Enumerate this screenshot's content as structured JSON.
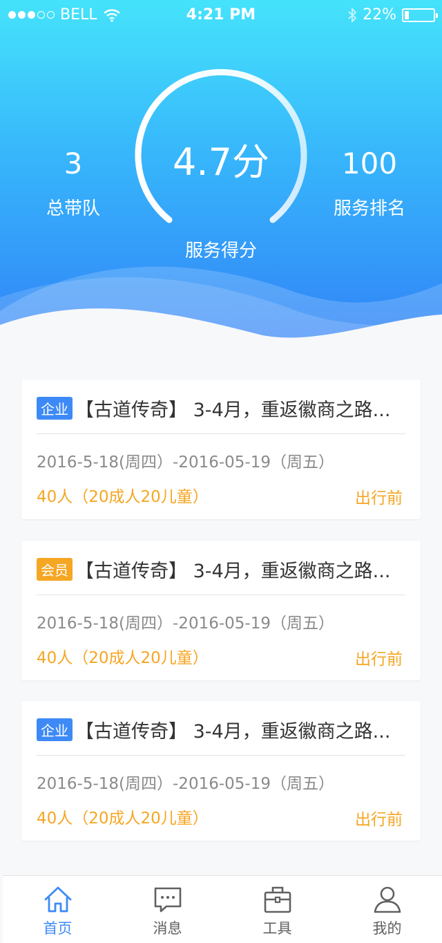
{
  "status_bar": {
    "carrier": "BELL",
    "signal_dots": 5,
    "signal_filled": 3,
    "time": "4:21 PM",
    "battery_percent": "22%",
    "battery_level": 0.22,
    "icons": [
      "wifi-icon",
      "bluetooth-icon",
      "battery-icon"
    ]
  },
  "summary": {
    "team_count": "3",
    "team_label": "总带队",
    "score": "4.7分",
    "score_label": "服务得分",
    "rank": "100",
    "rank_label": "服务排名"
  },
  "colors": {
    "header_top": "#45e3fb",
    "header_bottom": "#3182f7",
    "tag_enterprise": "#3d8af7",
    "tag_member": "#f5a623",
    "accent_orange": "#f5a623",
    "tab_active": "#3d8af7"
  },
  "trips": [
    {
      "tag": "企业",
      "tag_type": "enterprise",
      "title": "【古道传奇】 3-4月，重返徽商之路...",
      "date": "2016-5-18(周四）-2016-05-19（周五）",
      "people": "40人（20成人20儿童）",
      "status": "出行前"
    },
    {
      "tag": "会员",
      "tag_type": "member",
      "title": "【古道传奇】 3-4月，重返徽商之路...",
      "date": "2016-5-18(周四）-2016-05-19（周五）",
      "people": "40人（20成人20儿童）",
      "status": "出行前"
    },
    {
      "tag": "企业",
      "tag_type": "enterprise",
      "title": "【古道传奇】 3-4月，重返徽商之路...",
      "date": "2016-5-18(周四）-2016-05-19（周五）",
      "people": "40人（20成人20儿童）",
      "status": "出行前"
    }
  ],
  "tabbar": [
    {
      "label": "首页",
      "icon": "home-icon",
      "active": true
    },
    {
      "label": "消息",
      "icon": "message-icon",
      "active": false
    },
    {
      "label": "工具",
      "icon": "toolbox-icon",
      "active": false
    },
    {
      "label": "我的",
      "icon": "user-icon",
      "active": false
    }
  ]
}
